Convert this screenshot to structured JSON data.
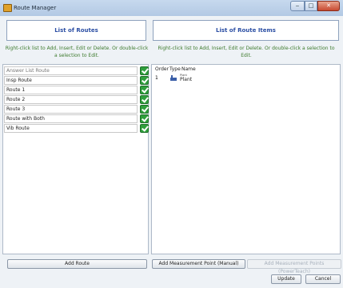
{
  "window": {
    "title": "Route Manager",
    "minimize_label": "‒",
    "maximize_label": "□",
    "close_label": "✕"
  },
  "left_panel": {
    "title": "List of Routes",
    "hint": "Right-click list to Add, Insert, Edit or Delete. Or double-click a selection to Edit.",
    "routes": [
      {
        "name": "Answer List Route",
        "checked": true
      },
      {
        "name": "Insp Route",
        "checked": true
      },
      {
        "name": "Route 1",
        "checked": true
      },
      {
        "name": "Route 2",
        "checked": true
      },
      {
        "name": "Route 3",
        "checked": true
      },
      {
        "name": "Route with Both",
        "checked": true
      },
      {
        "name": "Vib Route",
        "checked": true
      }
    ],
    "add_button": "Add Route"
  },
  "right_panel": {
    "title": "List of Route Items",
    "hint": "Right-click list to Add, Insert, Edit or Delete. Or double-click a selection to Edit.",
    "columns": [
      "Order",
      "Type",
      "Name"
    ],
    "items": [
      {
        "order": "1",
        "type_icon": "plant-icon",
        "name_small": "Plant",
        "name": "Plant"
      }
    ],
    "add_manual_button": "Add Measurement Point (Manual)",
    "add_powerteach_button": "Add Measurement Points (PowerTeach)"
  },
  "footer": {
    "update_button": "Update",
    "cancel_button": "Cancel"
  }
}
